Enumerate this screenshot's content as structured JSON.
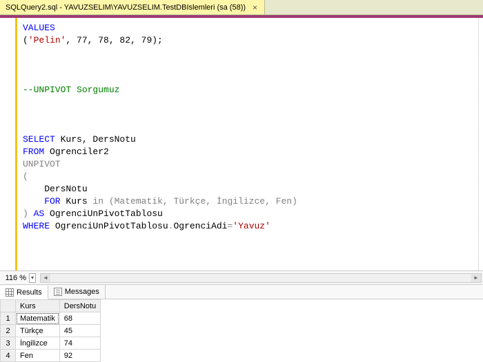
{
  "tab": {
    "title": "SQLQuery2.sql - YAVUZSELIM\\YAVUZSELIM.TestDBIslemleri (sa (58))",
    "close_glyph": "×"
  },
  "code": {
    "l1_kw": "VALUES",
    "l2_a": "(",
    "l2_str": "'Pelin'",
    "l2_b": ", 77, 78, 82, 79);",
    "l3_cmt": "--UNPIVOT Sorgumuz",
    "l4_select": "SELECT",
    "l4_cols": " Kurs, DersNotu",
    "l5_from": "FROM",
    "l5_tbl": " Ogrenciler2",
    "l6_unpivot": "UNPIVOT",
    "l7_paren": "(",
    "l8_ders": "    DersNotu",
    "l9_for": "    FOR",
    "l9_kurs": " Kurs ",
    "l9_in": "in",
    "l9_list": " (Matematik, Türkçe, İngilizce, Fen)",
    "l10_a": ") ",
    "l10_as": "AS",
    "l10_b": " OgrenciUnPivotTablosu",
    "l11_where": "WHERE",
    "l11_a": " OgrenciUnPivotTablosu",
    "l11_dot": ".",
    "l11_b": "OgrenciAdi",
    "l11_eq": "=",
    "l11_str": "'Yavuz'"
  },
  "zoom": {
    "value": "116 %",
    "dd_glyph": "▾",
    "left_glyph": "◄",
    "right_glyph": "►"
  },
  "resultTabs": {
    "results": "Results",
    "messages": "Messages"
  },
  "grid": {
    "headers": [
      "Kurs",
      "DersNotu"
    ],
    "rows": [
      {
        "n": "1",
        "kurs": "Matematik",
        "ders": "68"
      },
      {
        "n": "2",
        "kurs": "Türkçe",
        "ders": "45"
      },
      {
        "n": "3",
        "kurs": "İngilizce",
        "ders": "74"
      },
      {
        "n": "4",
        "kurs": "Fen",
        "ders": "92"
      }
    ]
  },
  "chart_data": {
    "type": "table",
    "title": "UNPIVOT result for OgrenciAdi='Yavuz'",
    "columns": [
      "Kurs",
      "DersNotu"
    ],
    "rows": [
      [
        "Matematik",
        68
      ],
      [
        "Türkçe",
        45
      ],
      [
        "İngilizce",
        74
      ],
      [
        "Fen",
        92
      ]
    ]
  }
}
